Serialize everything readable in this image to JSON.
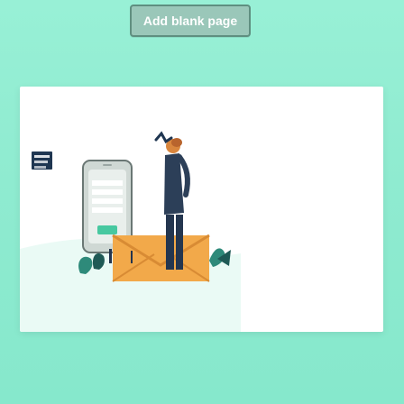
{
  "toolbar": {
    "add_blank_page_label": "Add blank page"
  },
  "icons": {
    "add_blank_page": "button",
    "page_illustration": "phone-person-envelope-illustration"
  },
  "colors": {
    "background": "#8febd0",
    "button": "#9ac7b9",
    "button_border": "#5f8f80",
    "card": "#ffffff",
    "accent_orange": "#f2a94a",
    "accent_green": "#47c8a0",
    "dark_navy": "#23344e"
  }
}
